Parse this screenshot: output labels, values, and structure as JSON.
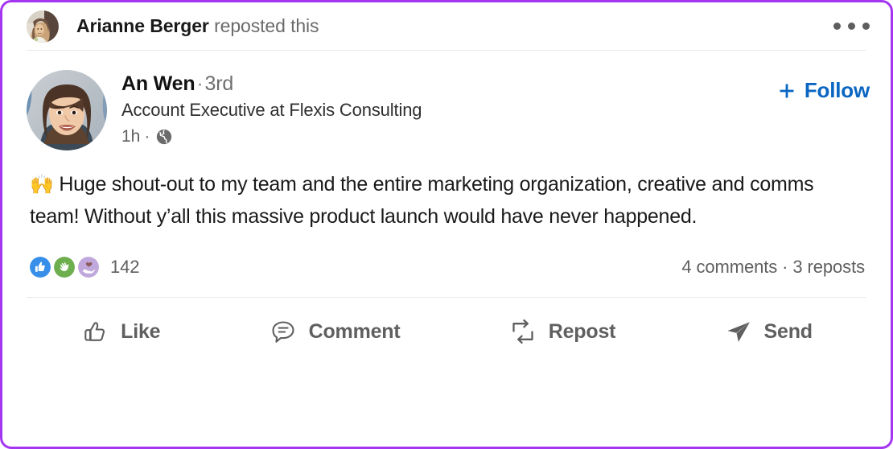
{
  "card": {
    "border_color": "#a435f0",
    "background": "#ffffff"
  },
  "repost_header": {
    "avatar_name": "arianne-berger-avatar",
    "resharer_name": "Arianne Berger",
    "action_text": " reposted this",
    "more_menu_label": "More options"
  },
  "author": {
    "avatar_name": "an-wen-avatar",
    "name": "An Wen",
    "separator": "·",
    "degree": "3rd",
    "headline": "Account Executive at Flexis Consulting",
    "timestamp": "1h",
    "time_separator": "·",
    "visibility_icon": "globe-icon",
    "visibility": "Public",
    "follow_label": "Follow",
    "follow_icon": "plus-icon",
    "follow_color": "#0a66c2"
  },
  "post": {
    "emoji": "🙌",
    "text": "Huge shout-out to my team and the entire marketing organization, creative and comms team! Without y’all this massive product launch would have never happened."
  },
  "social": {
    "reactions": [
      {
        "name": "like-reaction-icon",
        "label": "Like",
        "color": "#378fe9"
      },
      {
        "name": "celebrate-reaction-icon",
        "label": "Celebrate",
        "color": "#6dae4f"
      },
      {
        "name": "support-reaction-icon",
        "label": "Support",
        "color": "#c0a7dc"
      }
    ],
    "reaction_count": "142",
    "comments_reposts": "4 comments · 3 reposts"
  },
  "actions": [
    {
      "name": "like-button",
      "label": "Like",
      "icon": "thumbs-up-icon"
    },
    {
      "name": "comment-button",
      "label": "Comment",
      "icon": "speech-bubble-icon"
    },
    {
      "name": "repost-button",
      "label": "Repost",
      "icon": "repost-arrows-icon"
    },
    {
      "name": "send-button",
      "label": "Send",
      "icon": "paper-plane-icon"
    }
  ]
}
